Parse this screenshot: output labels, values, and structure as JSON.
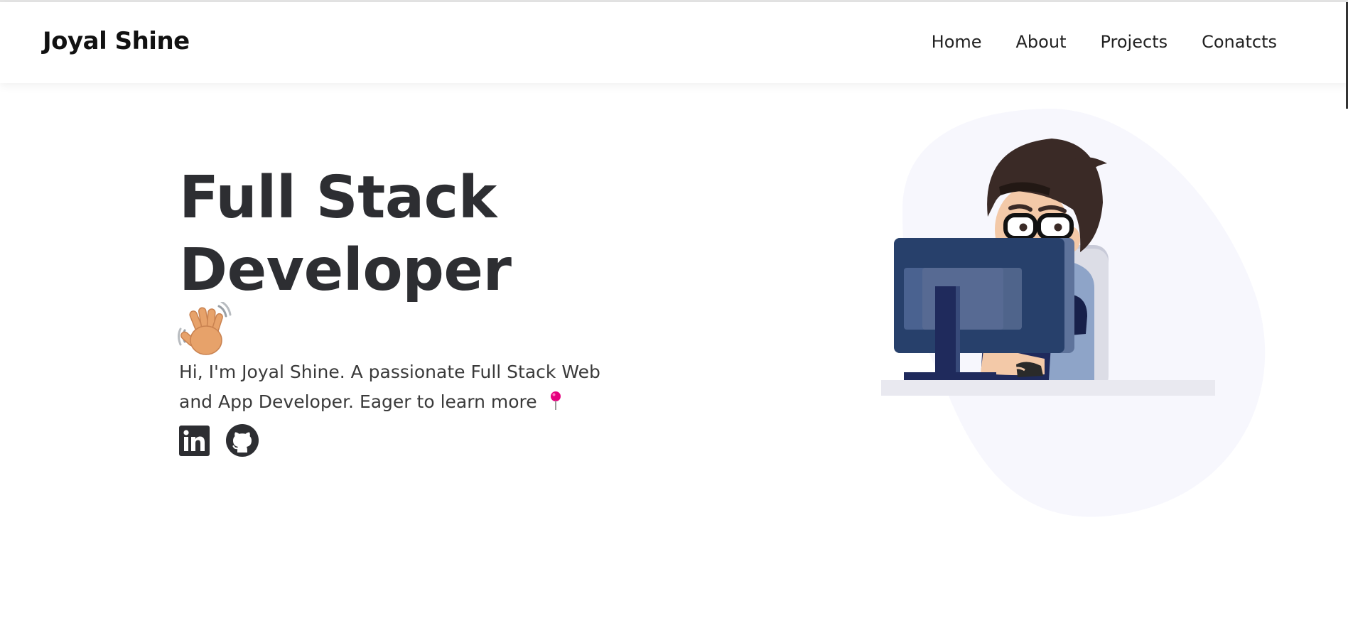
{
  "nav": {
    "brand": "Joyal Shine",
    "links": [
      "Home",
      "About",
      "Projects",
      "Conatcts"
    ]
  },
  "hero": {
    "title_line1": "Full Stack",
    "title_line2": "Developer",
    "wave_emoji": "waving-hand",
    "intro_text": "Hi, I'm Joyal Shine. A passionate Full Stack Web and App Developer. Eager to learn more",
    "pin_icon": "pushpin",
    "pin_color": "#e5007e"
  },
  "socials": [
    {
      "name": "linkedin-icon"
    },
    {
      "name": "github-icon"
    }
  ],
  "colors": {
    "text": "#2d2e32",
    "blob": "#f7f7fd",
    "monitor": "#27406b",
    "shirt": "#1f2a5c",
    "hair": "#3a2a26",
    "skin": "#f3c9a8"
  }
}
